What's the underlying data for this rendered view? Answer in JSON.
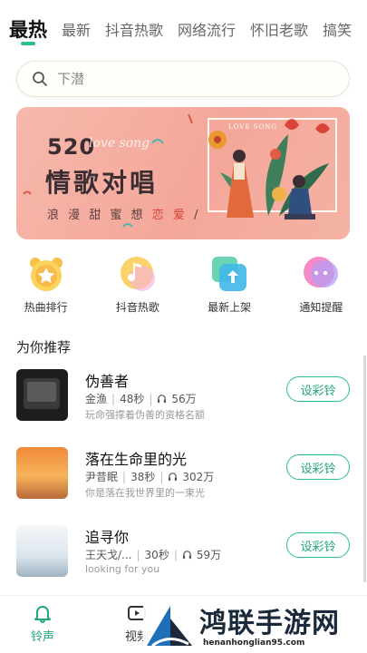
{
  "tabs": [
    {
      "label": "最热",
      "active": true
    },
    {
      "label": "最新"
    },
    {
      "label": "抖音热歌"
    },
    {
      "label": "网络流行"
    },
    {
      "label": "怀旧老歌"
    },
    {
      "label": "搞笑"
    }
  ],
  "search": {
    "placeholder": "下潜"
  },
  "banner": {
    "number": "520",
    "script": "love song",
    "title": "情歌对唱",
    "subtitle_a": "浪 漫 甜 蜜 想 ",
    "subtitle_accent": "恋 爱",
    "subtitle_b": " /",
    "frame_label": "LOVE SONG"
  },
  "quick": [
    {
      "label": "热曲排行",
      "icon": "alarm-star-icon"
    },
    {
      "label": "抖音热歌",
      "icon": "music-note-icon"
    },
    {
      "label": "最新上架",
      "icon": "upload-icon"
    },
    {
      "label": "通知提醒",
      "icon": "chat-bubble-icon"
    }
  ],
  "section": {
    "title": "为你推荐"
  },
  "songs": [
    {
      "title": "伪善者",
      "artist": "金渔",
      "duration": "48秒",
      "plays": "56万",
      "desc": "玩命强撑着伪善的资格名额",
      "button": "设彩铃"
    },
    {
      "title": "落在生命里的光",
      "artist": "尹昔眠",
      "duration": "38秒",
      "plays": "302万",
      "desc": "你是落在我世界里的一束光",
      "button": "设彩铃"
    },
    {
      "title": "追寻你",
      "artist": "王天戈/...",
      "duration": "30秒",
      "plays": "59万",
      "desc": "looking for you",
      "button": "设彩铃"
    }
  ],
  "nav": {
    "ringtone": "铃声",
    "video": "视频"
  },
  "watermark": {
    "text": "鸿联手游网",
    "url": "henanhonglian95.com"
  },
  "colors": {
    "accent": "#2bbf8a",
    "banner_bg": "#f4a79a"
  }
}
